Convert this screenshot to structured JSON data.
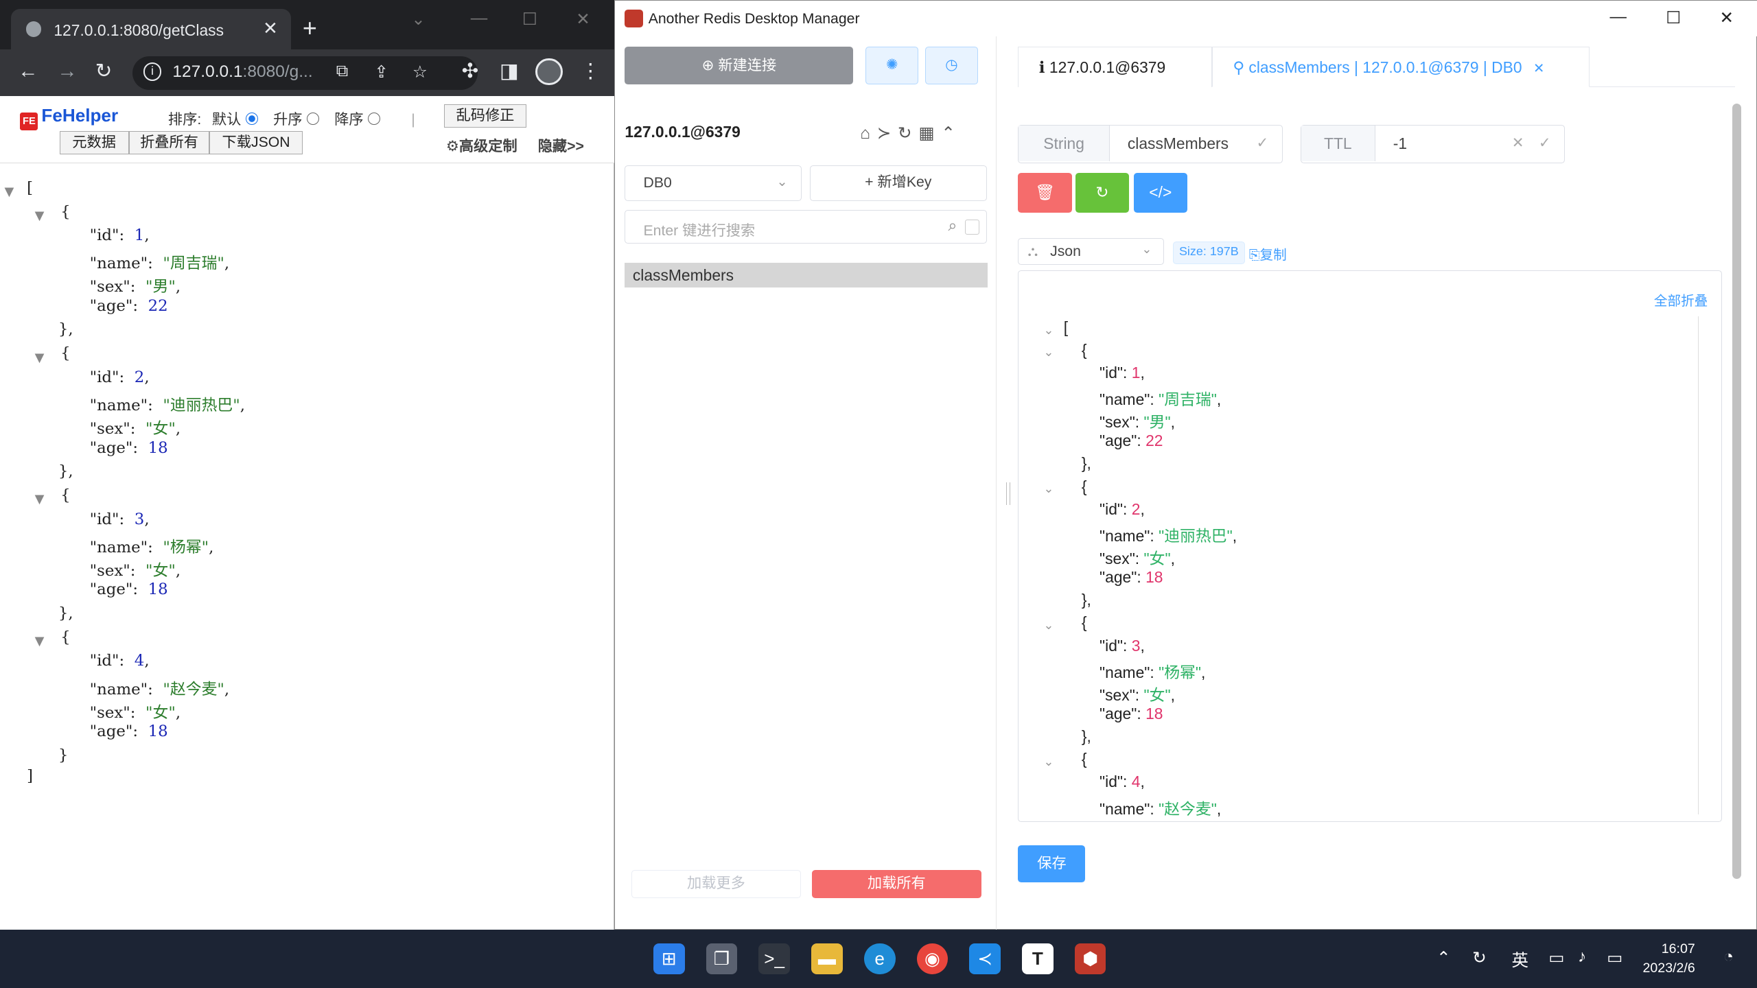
{
  "browser": {
    "tab_title": "127.0.0.1:8080/getClass",
    "url_host": "127.0.0.1",
    "url_rest": ":8080/g...",
    "fehelper": {
      "name": "FeHelper",
      "sort_label": "排序:",
      "sort_default": "默认",
      "sort_asc": "升序",
      "sort_desc": "降序",
      "fix_encoding": "乱码修正",
      "meta_data": "元数据",
      "fold_all": "折叠所有",
      "download_json": "下载JSON",
      "advanced": "⚙高级定制",
      "hide": "隐藏>>"
    },
    "json": [
      {
        "id": "1",
        "name": "周吉瑞",
        "sex": "男",
        "age": "22"
      },
      {
        "id": "2",
        "name": "迪丽热巴",
        "sex": "女",
        "age": "18"
      },
      {
        "id": "3",
        "name": "杨幂",
        "sex": "女",
        "age": "18"
      },
      {
        "id": "4",
        "name": "赵今麦",
        "sex": "女",
        "age": "18"
      }
    ]
  },
  "rdm": {
    "window_title": "Another Redis Desktop Manager",
    "new_connection": "新建连接",
    "connection_name": "127.0.0.1@6379",
    "db_select": "DB0",
    "new_key": "新增Key",
    "search_placeholder": "Enter 键进行搜索",
    "keys": [
      "classMembers"
    ],
    "load_more": "加载更多",
    "load_all": "加载所有",
    "tab_server": "127.0.0.1@6379",
    "tab_key": "classMembers | 127.0.0.1@6379 | DB0",
    "key_type": "String",
    "key_name": "classMembers",
    "ttl_label": "TTL",
    "ttl_value": "-1",
    "format": "Json",
    "size": "Size: 197B",
    "copy": "复制",
    "collapse_all": "全部折叠",
    "save": "保存",
    "colors": {
      "delete": "#f56c6c",
      "refresh": "#67c23a",
      "code": "#409eff"
    }
  },
  "taskbar": {
    "tray_lang": "英",
    "time": "16:07",
    "date": "2023/2/6"
  }
}
